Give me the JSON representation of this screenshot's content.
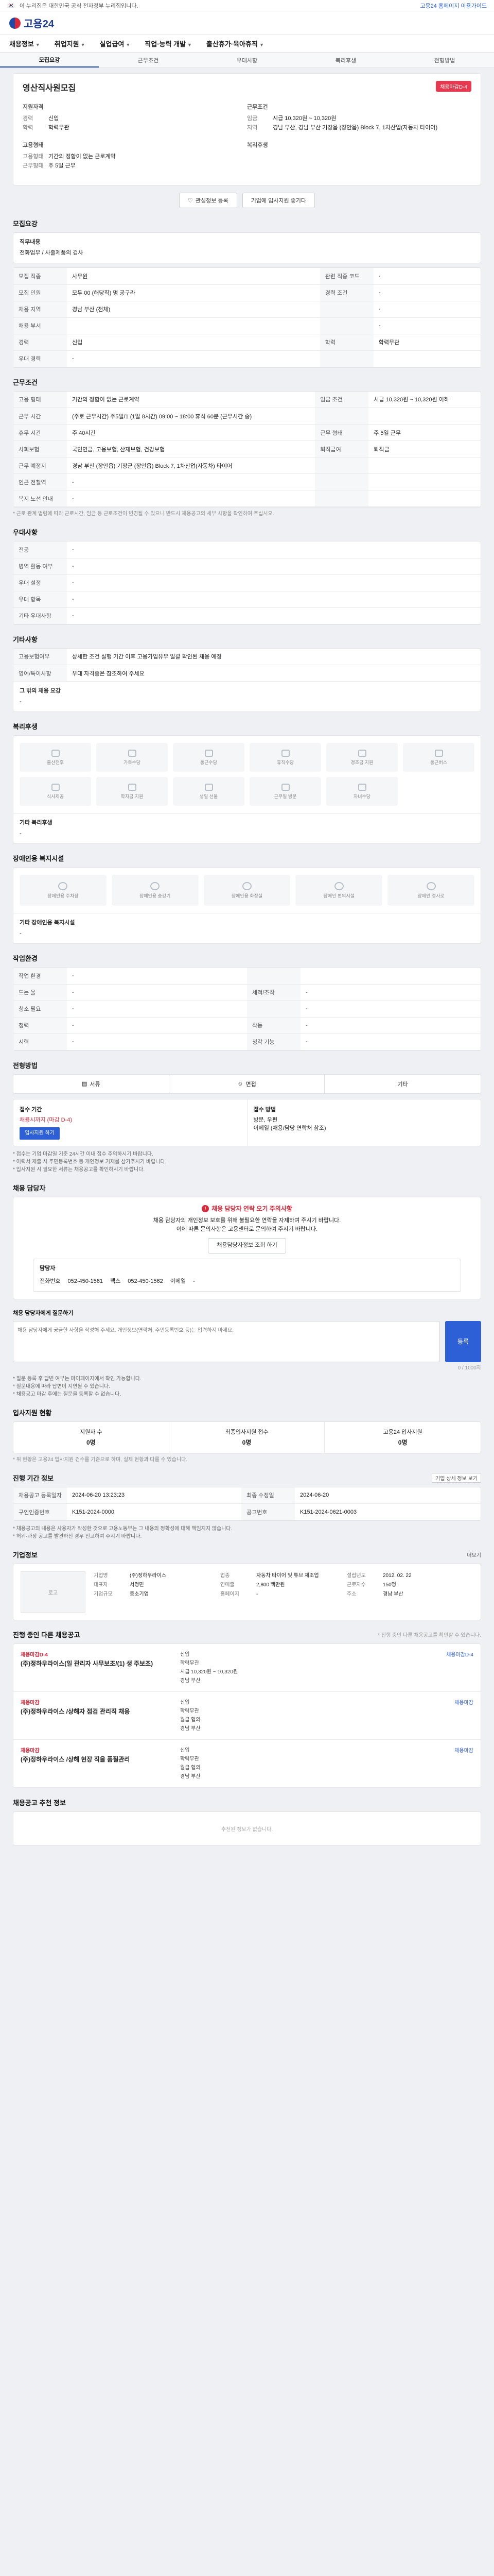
{
  "topbar": {
    "links": [
      "이 누리집은 대한민국 공식 전자정부 누리집입니다."
    ],
    "right": "고용24 홈페이지 이용가이드"
  },
  "brand": "고용24",
  "gnb": [
    "채용정보",
    "취업지원",
    "실업급여",
    "직업·능력 개발",
    "출산휴가·육아휴직"
  ],
  "subtabs": [
    "모집요강",
    "근무조건",
    "우대사항",
    "복리후생",
    "전형방법"
  ],
  "company": {
    "name": "영산직사원모집",
    "badge": "채용마감D-4",
    "group1": "지원자격",
    "career_k": "경력",
    "career_v": "신입",
    "edu_k": "학력",
    "edu_v": "학력무관",
    "group2": "근무조건",
    "pay_k": "임금",
    "pay_v": "시급 10,320원 ~ 10,320원",
    "loc_k": "지역",
    "loc_v": "경남 부산, 경남 부산 기장읍 (장안읍) Block 7, 1차산업(자동차 타이어)",
    "group3": "고용형태",
    "type_k": "고용형태",
    "type_v": "기간의 정함이 없는 근로계약",
    "time_k": "근무형태",
    "time_v": "주 5일 근무",
    "group4": "복리후생"
  },
  "buttons": {
    "fav": "관심정보 등록",
    "share": "기업에 입사지원 좋기다"
  },
  "recruit": {
    "title": "모집요강",
    "dutiesLabel": "직무내용",
    "duties": "전화업무 / 사출제품의 검사",
    "rows": [
      [
        "모집 직종",
        "사무원",
        "관련 직종 코드",
        "-"
      ],
      [
        "모집 인원",
        "모두 00 (해당직) 명 공구라",
        "경력 조건",
        "-"
      ],
      [
        "채용 지역",
        "경남 부산 (전체)",
        "",
        "-"
      ],
      [
        "채용 부서",
        "",
        "",
        "-"
      ],
      [
        "경력",
        "신입",
        "학력",
        "학력무관"
      ],
      [
        "우대 경력",
        "-",
        "",
        ""
      ]
    ]
  },
  "conditions": {
    "title": "근무조건",
    "rows": [
      [
        "고용 형태",
        "기간의 정함이 없는 근로계약",
        "임금 조건",
        "시급 10,320원 ~ 10,320원 이하"
      ],
      [
        "근무 시간",
        "(주로 근무시간) 주5일/1 (1일 8시간) 09:00 ~ 18:00 휴식 60분 (근무시간 중)",
        "",
        ""
      ],
      [
        "휴무 시간",
        "주 40시간",
        "근무 형태",
        "주 5일 근무"
      ],
      [
        "사회보험",
        "국민연금, 고용보험, 산재보험, 건강보험",
        "퇴직급여",
        "퇴직금"
      ],
      [
        "근무 예정지",
        "경남 부산 (장안읍) 기장군 (장안읍) Block 7, 1차산업(자동차) 타이어",
        "",
        ""
      ],
      [
        "인근 전철역",
        "-",
        "",
        ""
      ],
      [
        "복지 노선 안내",
        "-",
        "",
        ""
      ]
    ],
    "note": "* 근로 관계 법령에 따라 근로시간, 임금 등 근로조건이 변경될 수 있으니 반드시 채용공고의 세부 사항을 확인하여 주십시오.",
    "mapBtn": "지도 보기"
  },
  "prefer": {
    "title": "우대사항",
    "rows": [
      [
        "전공",
        "-"
      ],
      [
        "병역 활동 여부",
        "-"
      ],
      [
        "우대 설정",
        "-"
      ],
      [
        "우대 항목",
        "-"
      ],
      [
        "기타 우대사항",
        "-"
      ]
    ]
  },
  "etc": {
    "title": "기타사항",
    "rows": [
      [
        "고용보험여부",
        "상세한 조건 실행 기간 이후 고용가입유무 일괄 확인된 채용 예정"
      ],
      [
        "영어/특이사항",
        "우대 자격증은 참조하여 주세요"
      ]
    ],
    "more": "그 밖의 채용 요강",
    "moreVal": "-"
  },
  "benefits": {
    "title": "복리후생",
    "items": [
      "출산전후",
      "가족수당",
      "통근수당",
      "휴직수당",
      "경조금 지원",
      "통근버스",
      "식사제공",
      "학자금 지원",
      "생일 선물",
      "근무일 방문",
      "자녀수당"
    ],
    "etc": "기타 복리후생",
    "etcVal": "-"
  },
  "facilities": {
    "title": "장애인용 복지시설",
    "items": [
      "장애인용 주차장",
      "장애인용 승강기",
      "장애인용 화장실",
      "장애인 편의시설",
      "장애인 경사로"
    ],
    "etc": "기타 장애인용 복지시설",
    "etcVal": "-"
  },
  "screening": {
    "title": "작업환경",
    "rows": [
      [
        "작업 환경",
        "-",
        "",
        ""
      ],
      [
        "드는 물",
        "-",
        "세척/조작",
        "-"
      ],
      [
        "청소 필요",
        "-",
        "",
        "-"
      ],
      [
        "청력",
        "-",
        "작동",
        "-"
      ],
      [
        "시력",
        "-",
        "청각 기능",
        "-"
      ]
    ]
  },
  "apply": {
    "title": "전형방법",
    "methods": [
      "서류",
      "면접",
      "기타"
    ],
    "step_label": "접수 기간",
    "step_val": "채용시까지 (마감 D-4)",
    "method_label": "접수 방법",
    "method_val": "방문, 우편\n이메일 (채용/담당 연락처 참조)",
    "btn": "입사지원 하기",
    "bullets": [
      "* 접수는 기업 마감일 기준 24시간 이내 접수 주의하시기 바랍니다.",
      "* 이력서 제출 시 주민등록번호 등 개인정보 기재를 삼가주시기 바랍니다.",
      "* 입사지원 시 필요한 서류는 채용공고를 확인하시기 바랍니다."
    ]
  },
  "manager": {
    "title": "채용 담당자",
    "alertHead": "채용 담당자 연락 오기 주의사항",
    "alert": "채용 담당자의 개인정보 보호를 위해 불필요한 연락을 자제하여 주시기 바랍니다.",
    "alert2": "이에 따른 문의사항은 고용센터로 문의하여 주시기 바랍니다.",
    "checkBtn": "채용담당자정보 조회 하기",
    "mgrName": "담당자",
    "phone_k": "전화번호",
    "phone_v": "052-450-1561",
    "fax_k": "팩스",
    "fax_v": "052-450-1562",
    "mail_k": "이메일",
    "mail_v": "-"
  },
  "qna": {
    "title": "채용 담당자에게 질문하기",
    "placeholder": "채용 담당자에게 궁금한 사항을 작성해 주세요. 개인정보(연락처, 주민등록번호 등)는 입력하지 마세요.",
    "count": "0 / 1000자",
    "send": "등록",
    "notes": [
      "* 질문 등록 후 답변 여부는 마이페이지에서 확인 가능합니다.",
      "* 질문내용에 따라 답변이 지연될 수 있습니다.",
      "* 채용공고 마감 후에는 질문을 등록할 수 없습니다."
    ]
  },
  "status": {
    "title": "입사지원 현황",
    "items": [
      [
        "지원자 수",
        "0명"
      ],
      [
        "최종입사지원 접수",
        "0명"
      ],
      [
        "고용24 입사지원",
        "0명"
      ]
    ],
    "note": "* 위 현황은 고용24 입사지원 건수를 기준으로 하며, 실제 현황과 다를 수 있습니다."
  },
  "history": {
    "title": "진행 기간 정보",
    "btn": "기업 상세 정보 보기",
    "rows": [
      [
        "채용공고 등록일자",
        "2024-06-20 13:23:23",
        "최종 수정일",
        "2024-06-20"
      ],
      [
        "구인인증번호",
        "K151-2024-0000",
        "공고번호",
        "K151-2024-0621-0003"
      ]
    ],
    "notes": [
      "* 채용공고의 내용은 사용자가 작성한 것으로 고용노동부는 그 내용의 정확성에 대해 책임지지 않습니다.",
      "* 허위·과장 공고를 발견하신 경우 신고하여 주시기 바랍니다."
    ]
  },
  "corp": {
    "title": "기업정보",
    "more": "더보기",
    "logo": "로고",
    "info": [
      [
        "기업명",
        "(주)정하우라이스"
      ],
      [
        "업종",
        "자동차 타이어 및 튜브 제조업"
      ],
      [
        "설립년도",
        "2012. 02. 22"
      ],
      [
        "대표자",
        "서정민"
      ],
      [
        "연매출",
        "2,800 백만원"
      ],
      [
        "근로자수",
        "150명"
      ],
      [
        "기업규모",
        "중소기업"
      ],
      [
        "홈페이지",
        "-"
      ],
      [
        "주소",
        "경남 부산"
      ]
    ]
  },
  "ongoing": {
    "title": "진행 중인 다른 채용공고",
    "note": "* 진행 중인 다른 채용공고를 확인할 수 있습니다.",
    "items": [
      {
        "co": "채용마감D-4",
        "ttl": "(주)정하우라이스(일 관리자 사무보조/(1) 생 주보조)",
        "f1": "신입",
        "f2": "학력무관",
        "f3": "시급 10,320원 ~ 10,320원",
        "f4": "경남 부산",
        "link": "채용마감D-4"
      },
      {
        "co": "채용마감",
        "ttl": "(주)정하우라이스 /상해자 점검 관리직 채용",
        "f1": "신입",
        "f2": "학력무관",
        "f3": "월급 협의",
        "f4": "경남 부산",
        "link": "채용마감"
      },
      {
        "co": "채용마감",
        "ttl": "(주)정하우라이스 /상해 현장 직을 품질관리",
        "f1": "신입",
        "f2": "학력무관",
        "f3": "월급 협의",
        "f4": "경남 부산",
        "link": "채용마감"
      }
    ]
  },
  "recommend": {
    "title": "채용공고 추천 정보",
    "empty": "추천된 정보가 없습니다."
  }
}
